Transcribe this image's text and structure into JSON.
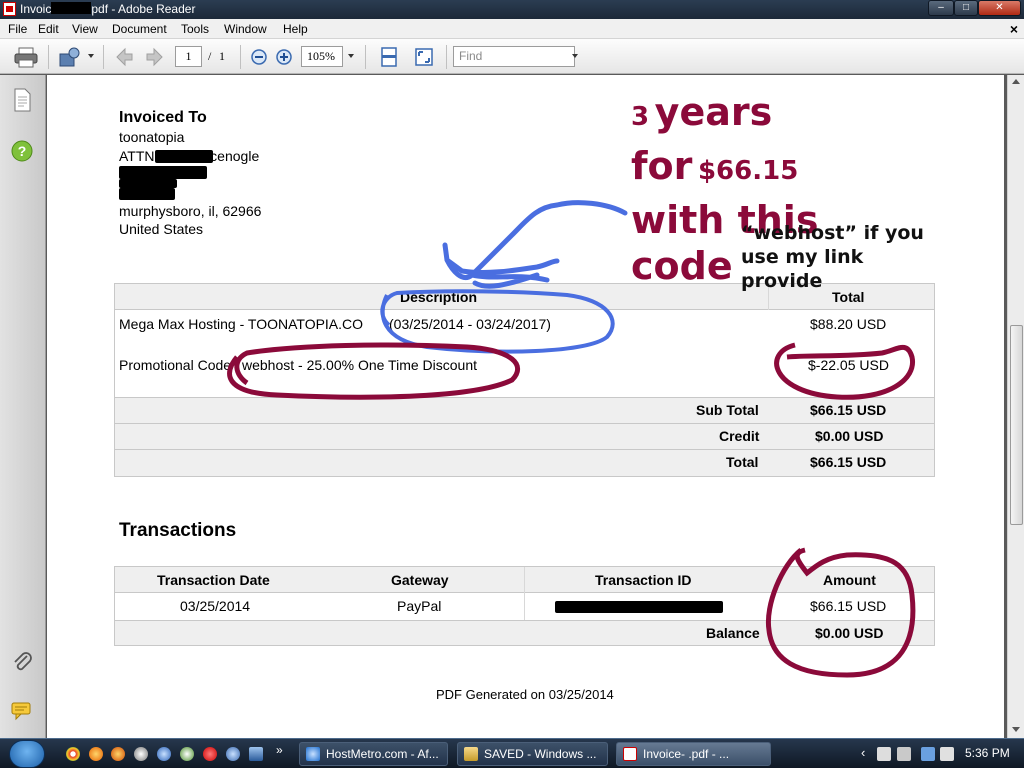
{
  "window": {
    "title": "Invoic…pdf - Adobe Reader",
    "title_prefix": "Invoic",
    "title_suffix": "pdf - Adobe Reader",
    "minimize": "–",
    "maximize": "□",
    "close": "✕"
  },
  "menu": {
    "items": [
      "File",
      "Edit",
      "View",
      "Document",
      "Tools",
      "Window",
      "Help"
    ],
    "close": "×"
  },
  "toolbar": {
    "page_current": "1",
    "page_sep": "/",
    "page_total": "1",
    "zoom": "105%",
    "find_placeholder": "Find"
  },
  "invoice": {
    "invoiced_to_heading": "Invoiced To",
    "company": "toonatopia",
    "attn_prefix": "ATTN:",
    "attn_name": "Icenogle",
    "city": "murphysboro, il, 62966",
    "country": "United States",
    "items_table": {
      "headers": {
        "description": "Description",
        "total": "Total"
      },
      "rows": [
        {
          "description": "Mega Max Hosting - TOONATOPIA.CO",
          "dates": "(03/25/2014 - 03/24/2017)",
          "total": "$88.20 USD"
        },
        {
          "description": "Promotional Code",
          "dates": "webhost - 25.00% One Time Discount",
          "total": "$-22.05 USD"
        }
      ],
      "summary": [
        {
          "label": "Sub Total",
          "value": "$66.15 USD"
        },
        {
          "label": "Credit",
          "value": "$0.00 USD"
        },
        {
          "label": "Total",
          "value": "$66.15 USD"
        }
      ]
    },
    "transactions_heading": "Transactions",
    "transactions_table": {
      "headers": [
        "Transaction Date",
        "Gateway",
        "Transaction ID",
        "Amount"
      ],
      "row": {
        "date": "03/25/2014",
        "gateway": "PayPal",
        "amount": "$66.15 USD"
      },
      "balance_label": "Balance",
      "balance_value": "$0.00 USD"
    },
    "generated": "PDF Generated on 03/25/2014"
  },
  "annotations": {
    "line1_num": "3",
    "line1_word": "years",
    "line2_word": "for",
    "line2_amount": "$66.15",
    "line3": "with this",
    "line4": "code",
    "note_line1": "“webhost” if you",
    "note_line2": "use my link",
    "note_line3": "provide",
    "ink_color": "#8b0a3a",
    "blue_ink": "#4a6ee0"
  },
  "taskbar": {
    "tasks": [
      "HostMetro.com - Af...",
      "SAVED - Windows ...",
      "Invoice-       .pdf - ..."
    ],
    "clock": "5:36 PM"
  }
}
